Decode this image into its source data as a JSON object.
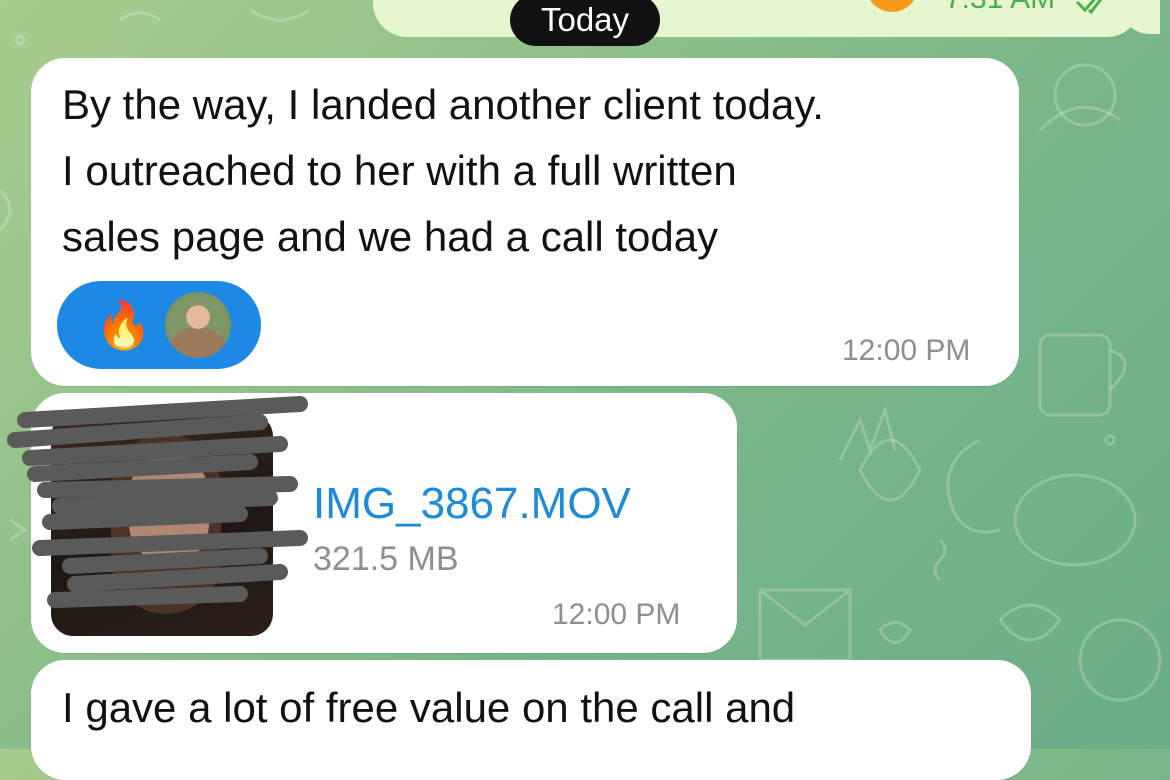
{
  "top_bar": {
    "date_label": "Today",
    "prev_outgoing_time": "7:31 AM"
  },
  "messages": [
    {
      "lines": [
        "By the way, I landed another client today.",
        "I outreached to her with a full written",
        "sales page and we had a call today"
      ],
      "reaction": {
        "emoji": "🔥"
      },
      "time": "12:00 PM"
    },
    {
      "file": {
        "name": "IMG_3867.MOV",
        "size": "321.5 MB"
      },
      "time": "12:00 PM"
    },
    {
      "lines": [
        "I gave a lot of free value on the call and"
      ]
    }
  ],
  "colors": {
    "link": "#1d8bd8",
    "reaction_bg": "#1e88e5",
    "date_pill_bg": "#111111",
    "outgoing_bg": "#e6f7d0",
    "read_check": "#4caf50"
  },
  "icons": [
    "flame-icon",
    "double-check-icon",
    "avatar"
  ]
}
